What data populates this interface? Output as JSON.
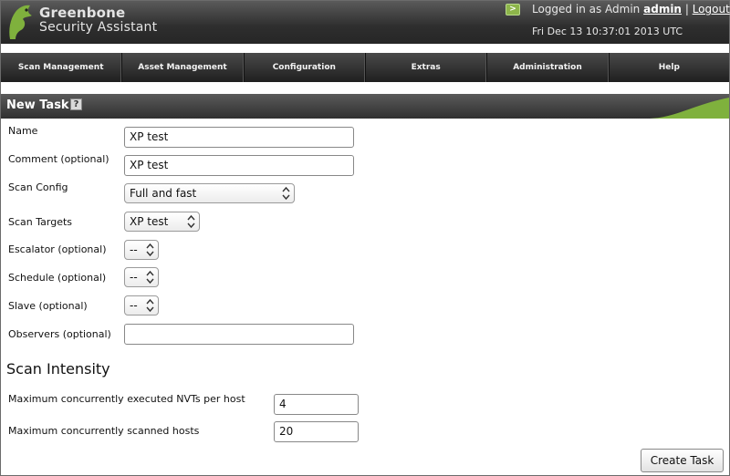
{
  "header": {
    "logo_line1": "Greenbone",
    "logo_line2": "Security Assistant",
    "user_icon": ">",
    "logged_in_prefix": "Logged in as Admin",
    "username": "admin",
    "separator": "|",
    "logout": "Logout",
    "datetime": "Fri Dec 13 10:37:01 2013 UTC"
  },
  "nav": [
    {
      "label": "Scan Management"
    },
    {
      "label": "Asset Management"
    },
    {
      "label": "Configuration"
    },
    {
      "label": "Extras"
    },
    {
      "label": "Administration"
    },
    {
      "label": "Help"
    }
  ],
  "section": {
    "title": "New Task",
    "help_glyph": "?"
  },
  "form": {
    "name_label": "Name",
    "name_value": "XP test",
    "comment_label": "Comment (optional)",
    "comment_value": "XP test",
    "scan_config_label": "Scan Config",
    "scan_config_value": "Full and fast",
    "scan_targets_label": "Scan Targets",
    "scan_targets_value": "XP test",
    "escalator_label": "Escalator (optional)",
    "escalator_value": "--",
    "schedule_label": "Schedule (optional)",
    "schedule_value": "--",
    "slave_label": "Slave (optional)",
    "slave_value": "--",
    "observers_label": "Observers (optional)",
    "observers_value": ""
  },
  "intensity": {
    "heading": "Scan Intensity",
    "max_nvts_label": "Maximum concurrently executed NVTs per host",
    "max_nvts_value": "4",
    "max_hosts_label": "Maximum concurrently scanned hosts",
    "max_hosts_value": "20"
  },
  "actions": {
    "create_task": "Create Task"
  },
  "colors": {
    "brand_green": "#8db54a",
    "header_dark": "#2e2e2e"
  }
}
